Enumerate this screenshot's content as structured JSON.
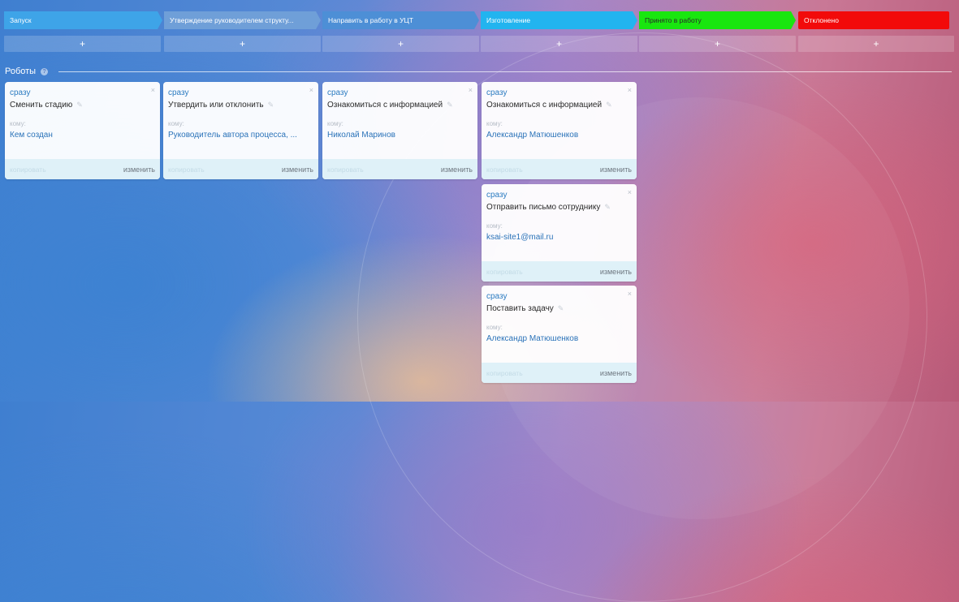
{
  "stages": [
    {
      "label": "Запуск",
      "color": "#3ea4e8"
    },
    {
      "label": "Утверждение руководителем структу...",
      "color": "#6f9fd8"
    },
    {
      "label": "Направить в работу в УЦТ",
      "color": "#4d8fd6"
    },
    {
      "label": "Изготовление",
      "color": "#22b4ef"
    },
    {
      "label": "Принято в работу",
      "color": "#19e60f"
    },
    {
      "label": "Отклонено",
      "color": "#f20a0a"
    }
  ],
  "add_label": "+",
  "robots": {
    "title": "Роботы",
    "help": "?"
  },
  "card_labels": {
    "close": "×",
    "to": "кому:",
    "copy": "копировать",
    "edit": "изменить",
    "pencil": "✎"
  },
  "cards": [
    {
      "when": "сразу",
      "name": "Сменить стадию",
      "to": "Кем создан"
    },
    {
      "when": "сразу",
      "name": "Утвердить или отклонить",
      "to": "Руководитель автора процесса, ..."
    },
    {
      "when": "сразу",
      "name": "Ознакомиться с информацией",
      "to": "Николай Маринов"
    },
    {
      "when": "сразу",
      "name": "Ознакомиться с информацией",
      "to": "Александр Матюшенков"
    },
    {
      "when": "сразу",
      "name": "Отправить письмо сотруднику",
      "to": "ksai-site1@mail.ru"
    },
    {
      "when": "сразу",
      "name": "Поставить задачу",
      "to": "Александр Матюшенков"
    }
  ]
}
